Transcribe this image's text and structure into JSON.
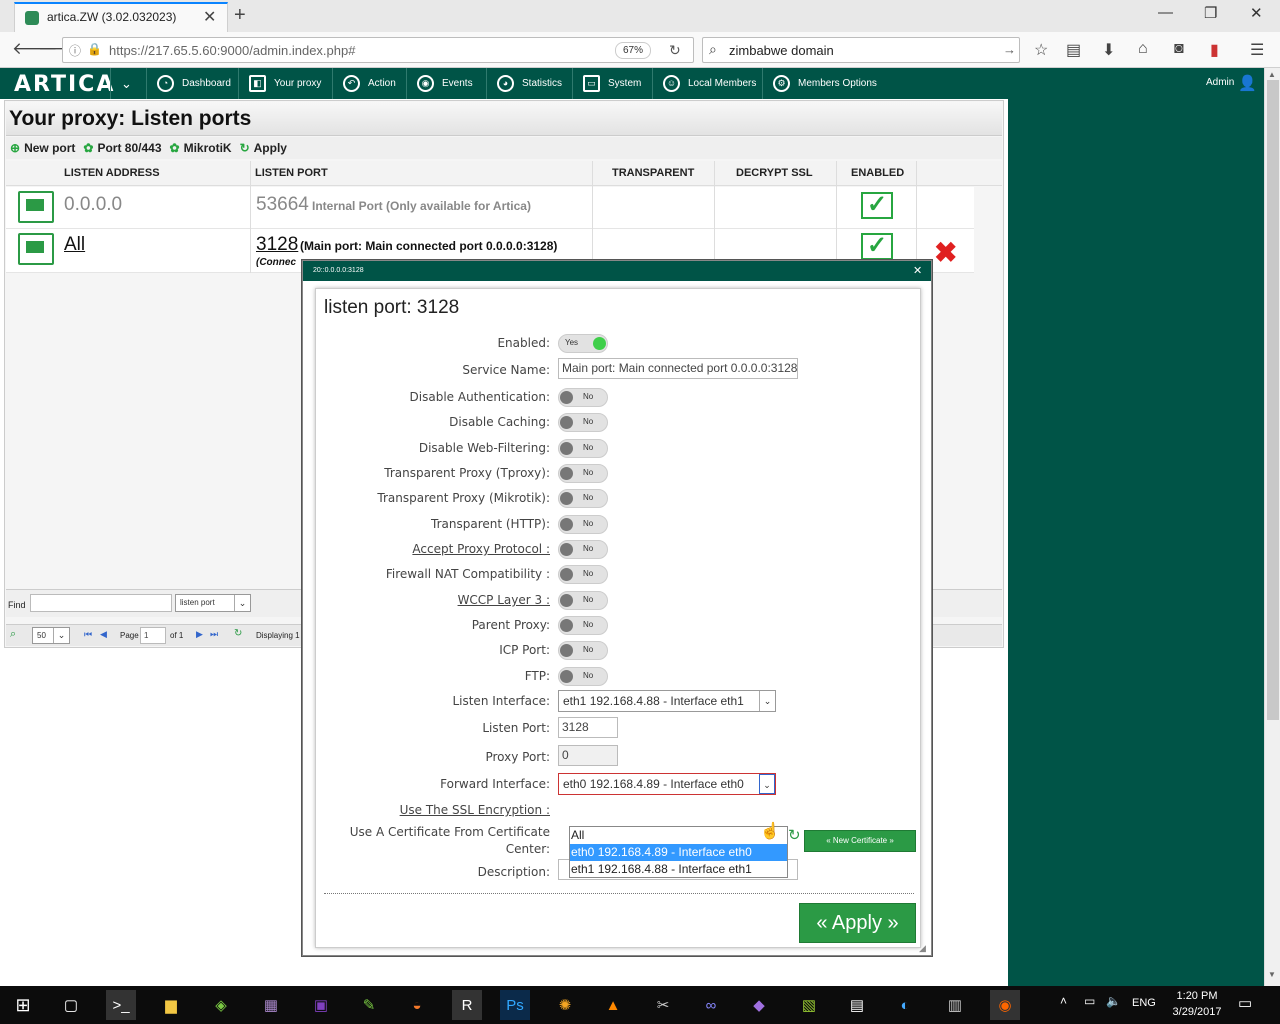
{
  "browser": {
    "tab_title": "artica.ZW (3.02.032023)",
    "url": "https://217.65.5.60:9000/admin.index.php#",
    "url_host": "217.65.5.60",
    "zoom": "67%",
    "search_text": "zimbabwe domain"
  },
  "app": {
    "logo": "ARTICA",
    "menu": [
      "Dashboard",
      "Your proxy",
      "Action",
      "Events",
      "Statistics",
      "System",
      "Local Members",
      "Members Options"
    ],
    "user": "Admin"
  },
  "page": {
    "title": "Your proxy: Listen ports",
    "toolbar": {
      "new_port": "New port",
      "port_80": "Port 80/443",
      "mikrotik": "MikrotiK",
      "apply": "Apply"
    },
    "columns": [
      "LISTEN ADDRESS",
      "LISTEN PORT",
      "TRANSPARENT",
      "DECRYPT SSL",
      "ENABLED"
    ],
    "rows": [
      {
        "address": "0.0.0.0",
        "port": "53664",
        "desc": "Internal Port (Only available for Artica)"
      },
      {
        "address": "All",
        "port": "3128",
        "desc": "(Main port: Main connected port 0.0.0.0:3128)",
        "sub": "(Connec"
      }
    ],
    "find_label": "Find",
    "find_select": "listen port",
    "pager": {
      "per_page": "50",
      "page_label": "Page",
      "page_value": "1",
      "of": "of 1",
      "display": "Displaying 1 t"
    }
  },
  "dialog": {
    "titlebar": "20::0.0.0.0:3128",
    "heading": "listen port: 3128",
    "enabled_label": "Enabled:",
    "enabled_value": "Yes",
    "service_name_label": "Service Name:",
    "service_name_value": "Main port: Main connected port 0.0.0.0:3128",
    "toggles": [
      {
        "label": "Disable Authentication:",
        "value": "No"
      },
      {
        "label": "Disable Caching:",
        "value": "No"
      },
      {
        "label": "Disable Web-Filtering:",
        "value": "No"
      },
      {
        "label": "Transparent Proxy (Tproxy):",
        "value": "No"
      },
      {
        "label": "Transparent Proxy (Mikrotik):",
        "value": "No"
      },
      {
        "label": "Transparent (HTTP):",
        "value": "No"
      },
      {
        "label": "Accept Proxy Protocol :",
        "value": "No"
      },
      {
        "label": "Firewall NAT Compatibility :",
        "value": "No"
      },
      {
        "label": "WCCP Layer 3 :",
        "value": "No"
      },
      {
        "label": "Parent Proxy:",
        "value": "No"
      },
      {
        "label": "ICP Port:",
        "value": "No"
      },
      {
        "label": "FTP:",
        "value": "No"
      }
    ],
    "listen_interface_label": "Listen Interface:",
    "listen_interface_value": "eth1 192.168.4.88 - Interface eth1",
    "listen_port_label": "Listen Port:",
    "listen_port_value": "3128",
    "proxy_port_label": "Proxy Port:",
    "proxy_port_value": "0",
    "forward_interface_label": "Forward Interface:",
    "forward_interface_value": "eth0 192.168.4.89 - Interface eth0",
    "forward_options": [
      "All",
      "eth0 192.168.4.89 - Interface eth0",
      "eth1 192.168.4.88 - Interface eth1"
    ],
    "ssl_label": "Use The SSL Encryption :",
    "cert_label_1": "Use A Certificate From Certificate",
    "cert_label_2": "Center:",
    "new_cert_button": "« New Certificate »",
    "description_label": "Description:",
    "apply_button": "« Apply »"
  },
  "taskbar": {
    "lang": "ENG",
    "time": "1:20 PM",
    "date": "3/29/2017"
  }
}
